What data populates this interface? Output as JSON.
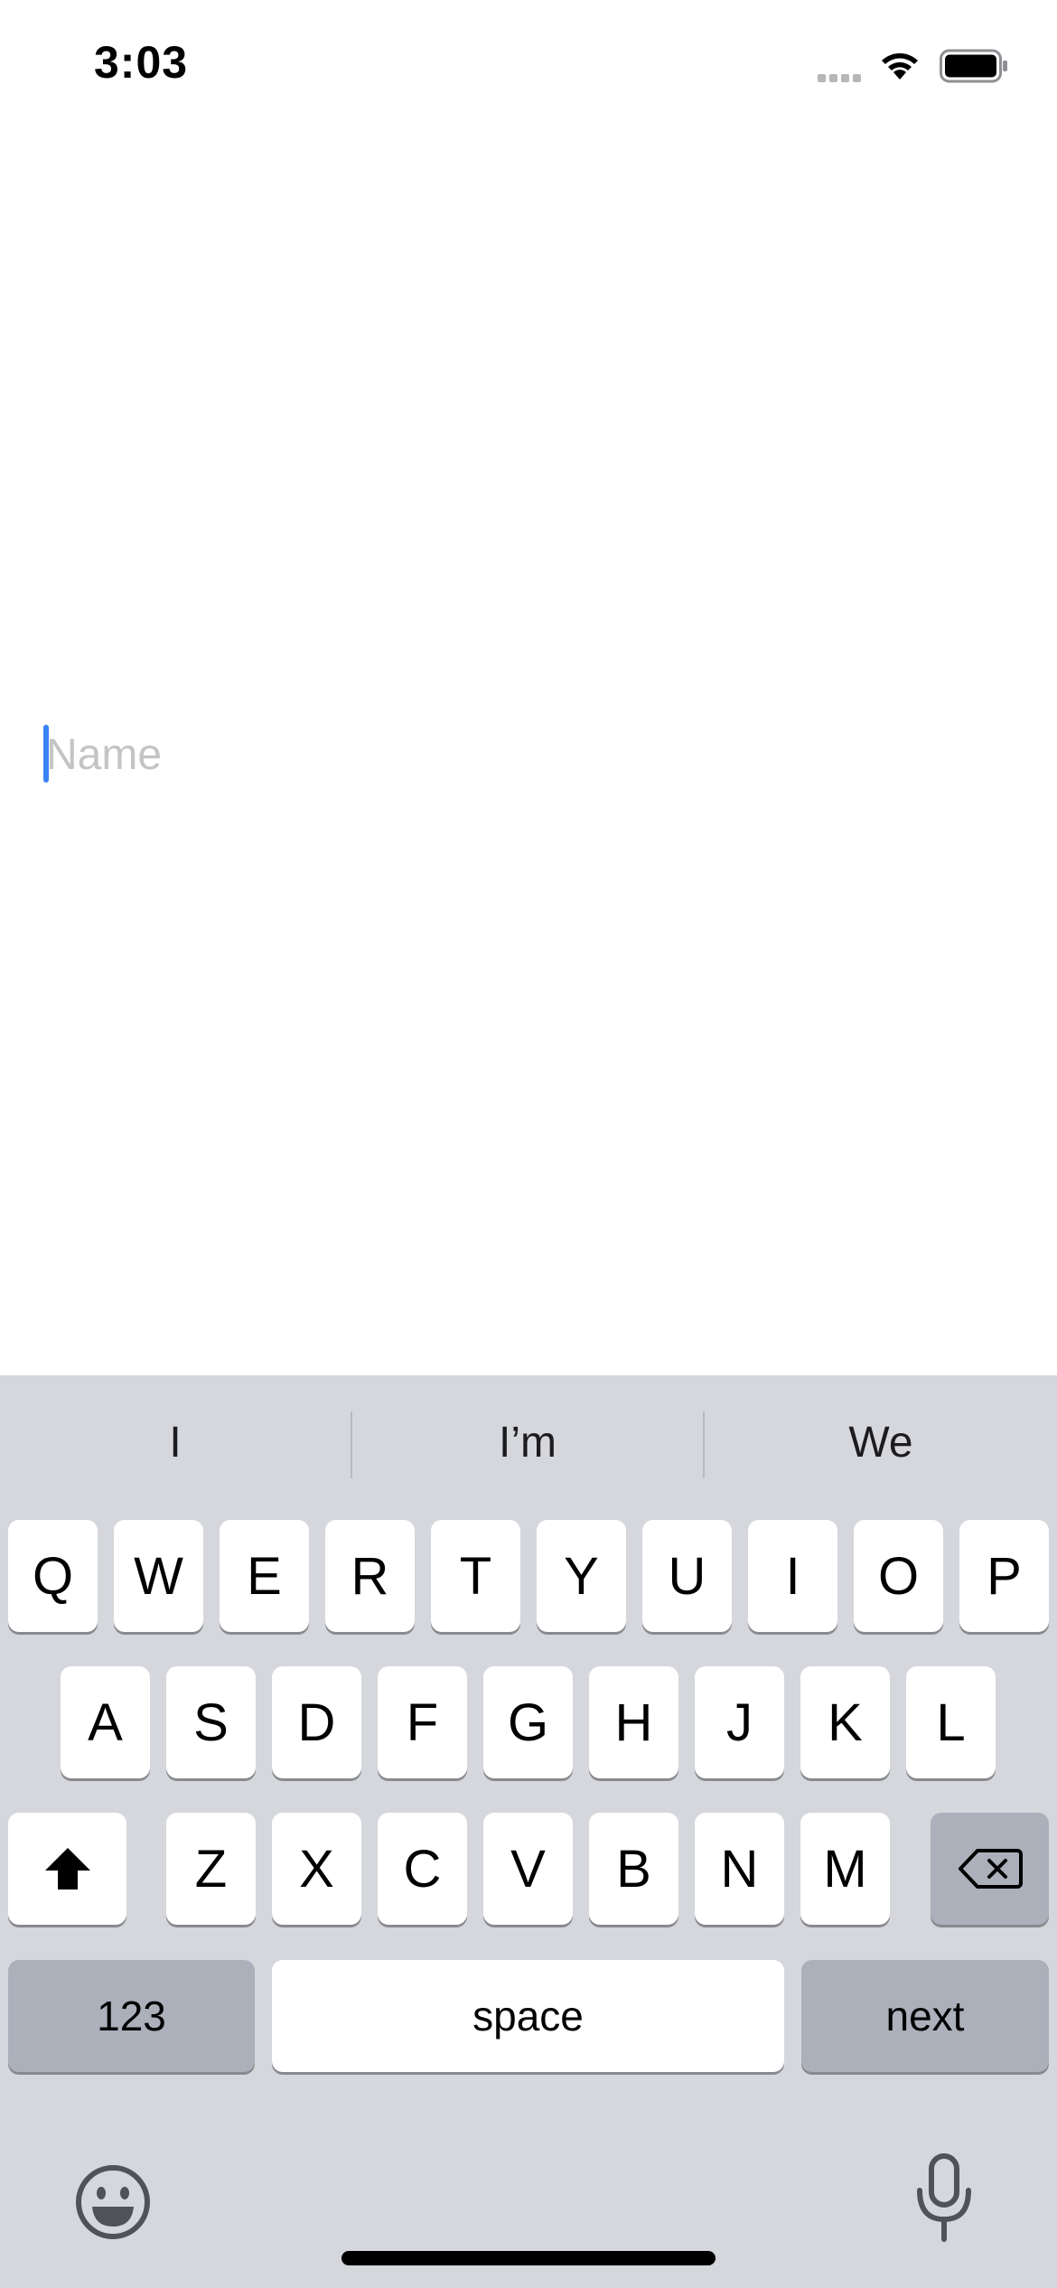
{
  "status_bar": {
    "time": "3:03",
    "icons": [
      "cellular-signal-icon",
      "wifi-icon",
      "battery-icon"
    ]
  },
  "form": {
    "name_placeholder": "Name",
    "name_value": ""
  },
  "keyboard": {
    "suggestions": [
      "I",
      "I’m",
      "We"
    ],
    "rows": [
      [
        "Q",
        "W",
        "E",
        "R",
        "T",
        "Y",
        "U",
        "I",
        "O",
        "P"
      ],
      [
        "A",
        "S",
        "D",
        "F",
        "G",
        "H",
        "J",
        "K",
        "L"
      ],
      [
        "Z",
        "X",
        "C",
        "V",
        "B",
        "N",
        "M"
      ]
    ],
    "numbers_label": "123",
    "space_label": "space",
    "return_label": "next",
    "icons": {
      "shift": "shift-icon",
      "delete": "delete-icon",
      "emoji": "emoji-icon",
      "dictation": "microphone-icon"
    }
  },
  "colors": {
    "caret": "#3a82f7",
    "keyboard_bg": "#d5d7dc",
    "key_bg": "#ffffff",
    "function_key_bg": "#abb0bb"
  }
}
